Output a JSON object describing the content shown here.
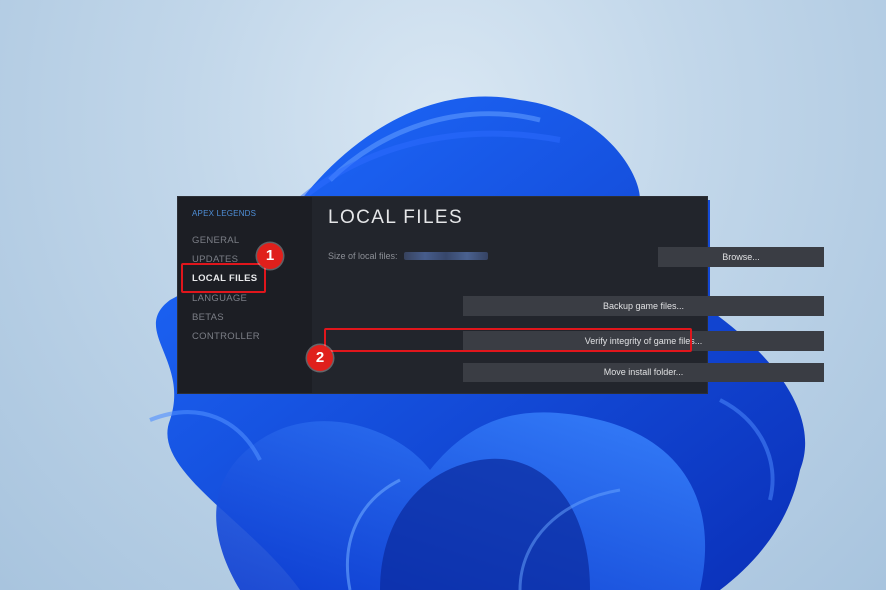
{
  "sidebar": {
    "game_title": "APEX LEGENDS",
    "items": [
      {
        "label": "GENERAL"
      },
      {
        "label": "UPDATES"
      },
      {
        "label": "LOCAL FILES"
      },
      {
        "label": "LANGUAGE"
      },
      {
        "label": "BETAS"
      },
      {
        "label": "CONTROLLER"
      }
    ]
  },
  "main": {
    "title": "LOCAL FILES",
    "size_label": "Size of local files:",
    "browse_label": "Browse...",
    "backup_label": "Backup game files...",
    "verify_label": "Verify integrity of game files...",
    "move_label": "Move install folder..."
  },
  "annotations": {
    "step1": "1",
    "step2": "2"
  },
  "colors": {
    "highlight": "#e0161c",
    "accent": "#4e8ed6"
  }
}
